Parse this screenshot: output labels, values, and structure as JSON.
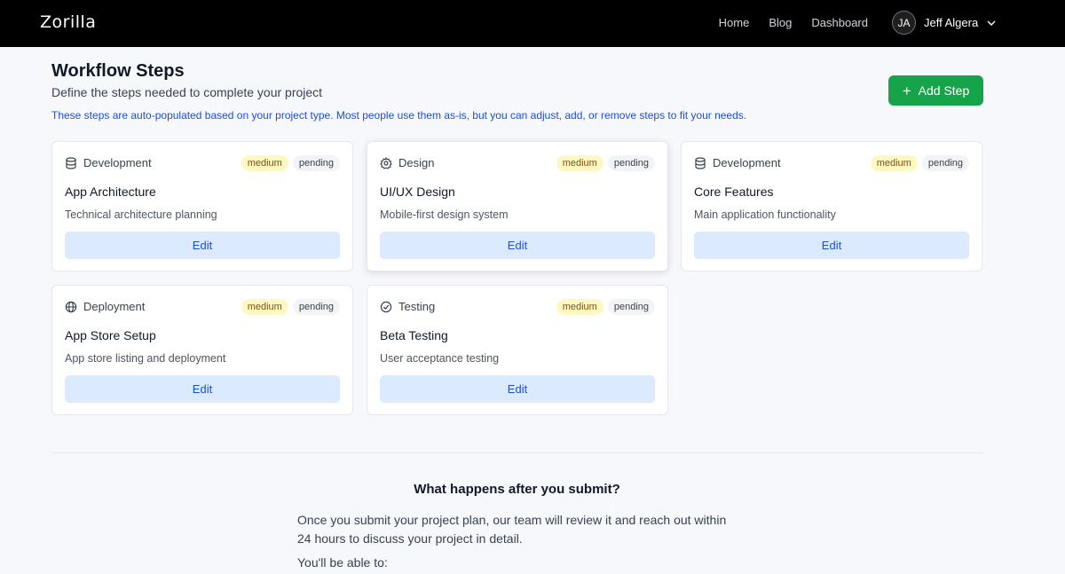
{
  "app": {
    "logo": "Zorilla",
    "nav": [
      {
        "label": "Home"
      },
      {
        "label": "Blog"
      },
      {
        "label": "Dashboard"
      }
    ],
    "user": {
      "initials": "JA",
      "name": "Jeff Algera"
    }
  },
  "header": {
    "title": "Workflow Steps",
    "subtitle": "Define the steps needed to complete your project",
    "note": "These steps are auto-populated based on your project type. Most people use them as-is, but you can adjust, add, or remove steps to fit your needs.",
    "add_button": "Add Step"
  },
  "steps": [
    {
      "category": "Development",
      "icon": "database-icon",
      "priority": "medium",
      "status": "pending",
      "title": "App Architecture",
      "description": "Technical architecture planning",
      "edit_label": "Edit"
    },
    {
      "category": "Design",
      "icon": "gear-icon",
      "priority": "medium",
      "status": "pending",
      "title": "UI/UX Design",
      "description": "Mobile-first design system",
      "edit_label": "Edit"
    },
    {
      "category": "Development",
      "icon": "database-icon",
      "priority": "medium",
      "status": "pending",
      "title": "Core Features",
      "description": "Main application functionality",
      "edit_label": "Edit"
    },
    {
      "category": "Deployment",
      "icon": "globe-icon",
      "priority": "medium",
      "status": "pending",
      "title": "App Store Setup",
      "description": "App store listing and deployment",
      "edit_label": "Edit"
    },
    {
      "category": "Testing",
      "icon": "check-circle-icon",
      "priority": "medium",
      "status": "pending",
      "title": "Beta Testing",
      "description": "User acceptance testing",
      "edit_label": "Edit"
    }
  ],
  "after_submit": {
    "title": "What happens after you submit?",
    "text": "Once you submit your project plan, our team will review it and reach out within 24 hours to discuss your project in detail.",
    "list_title": "You'll be able to:"
  },
  "colors": {
    "topbar": "#000000",
    "accent_green": "#16a34a",
    "edit_button_bg": "#dbeafe",
    "note_blue": "#1d4ed8",
    "priority_badge": "#fef9c3"
  }
}
